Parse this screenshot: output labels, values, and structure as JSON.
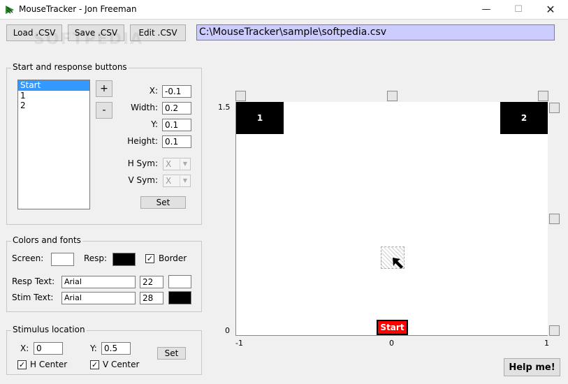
{
  "window": {
    "title": "MouseTracker - Jon Freeman",
    "minimize": "—",
    "maximize": "☐",
    "close": "✕",
    "icon": "mouse-app-icon"
  },
  "toolbar": {
    "load_label": "Load .CSV",
    "save_label": "Save .CSV",
    "edit_label": "Edit .CSV",
    "file_path": "C:\\MouseTracker\\sample\\softpedia.csv"
  },
  "watermark": "SOFTPEDIA",
  "buttons_group": {
    "title": "Start and response buttons",
    "list": [
      "Start",
      "1",
      "2"
    ],
    "selected_index": 0,
    "add_label": "+",
    "remove_label": "-",
    "x_label": "X:",
    "x_value": "-0.1",
    "width_label": "Width:",
    "width_value": "0.2",
    "y_label": "Y:",
    "y_value": "0.1",
    "height_label": "Height:",
    "height_value": "0.1",
    "hsym_label": "H Sym:",
    "hsym_value": "X",
    "vsym_label": "V Sym:",
    "vsym_value": "X",
    "set_label": "Set"
  },
  "colors_group": {
    "title": "Colors and fonts",
    "screen_label": "Screen:",
    "screen_color": "#ffffff",
    "resp_label": "Resp:",
    "resp_color": "#000000",
    "border_label": "Border",
    "border_checked": true,
    "resp_text_label": "Resp Text:",
    "resp_font": "Arial",
    "resp_size": "22",
    "resp_text_color": "#ffffff",
    "stim_text_label": "Stim Text:",
    "stim_font": "Arial",
    "stim_size": "28",
    "stim_text_color": "#000000"
  },
  "stimulus_group": {
    "title": "Stimulus location",
    "x_label": "X:",
    "x_value": "0",
    "y_label": "Y:",
    "y_value": "0.5",
    "set_label": "Set",
    "hcenter_label": "H Center",
    "hcenter_checked": true,
    "vcenter_label": "V Center",
    "vcenter_checked": true
  },
  "preview": {
    "y_top": "1.5",
    "y_bottom": "0",
    "x_left": "-1",
    "x_mid": "0",
    "x_right": "1",
    "resp1_label": "1",
    "resp2_label": "2",
    "start_label": "Start"
  },
  "help_label": "Help me!"
}
